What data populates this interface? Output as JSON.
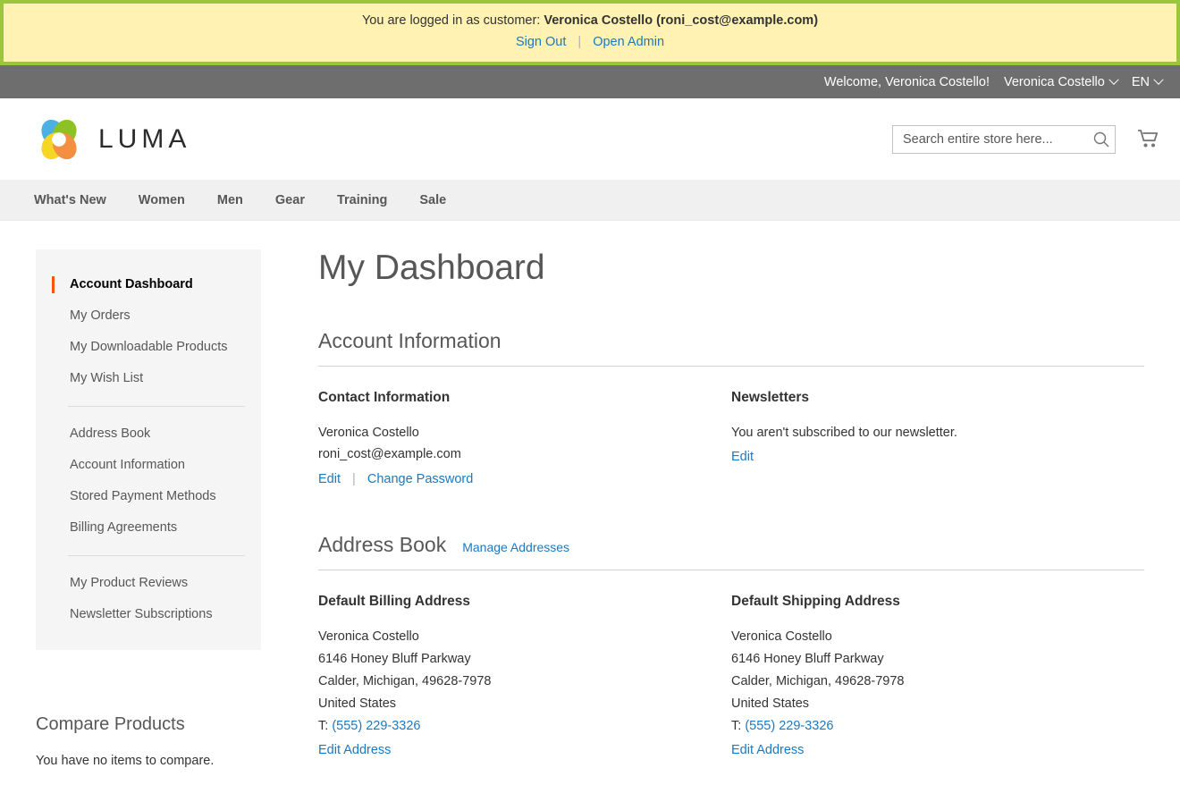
{
  "impersonation": {
    "message_prefix": "You are logged in as customer:",
    "customer": "Veronica Costello (roni_cost@example.com)",
    "sign_out": "Sign Out",
    "open_admin": "Open Admin",
    "separator": "|",
    "banner_bg": "#fff2b3",
    "banner_border": "#9ac63b"
  },
  "panel": {
    "welcome": "Welcome, Veronica Costello!",
    "account_menu": "Veronica Costello",
    "language_menu": "EN",
    "bg": "#6e6e6e"
  },
  "header": {
    "logo_text": "LUMA",
    "search": {
      "placeholder": "Search entire store here...",
      "value": "",
      "icon": "search-icon"
    },
    "cart_icon": "shopping-cart-icon"
  },
  "nav": {
    "items": [
      {
        "label": "What's New"
      },
      {
        "label": "Women"
      },
      {
        "label": "Men"
      },
      {
        "label": "Gear"
      },
      {
        "label": "Training"
      },
      {
        "label": "Sale"
      }
    ]
  },
  "sidebar": {
    "groups": [
      {
        "items": [
          {
            "label": "Account Dashboard",
            "current": true
          },
          {
            "label": "My Orders",
            "current": false
          },
          {
            "label": "My Downloadable Products",
            "current": false
          },
          {
            "label": "My Wish List",
            "current": false
          }
        ]
      },
      {
        "items": [
          {
            "label": "Address Book",
            "current": false
          },
          {
            "label": "Account Information",
            "current": false
          },
          {
            "label": "Stored Payment Methods",
            "current": false
          },
          {
            "label": "Billing Agreements",
            "current": false
          }
        ]
      },
      {
        "items": [
          {
            "label": "My Product Reviews",
            "current": false
          },
          {
            "label": "Newsletter Subscriptions",
            "current": false
          }
        ]
      }
    ],
    "active_color": "#ff5501",
    "compare": {
      "title": "Compare Products",
      "empty_text": "You have no items to compare."
    }
  },
  "main": {
    "page_title": "My Dashboard",
    "account_information": {
      "heading": "Account Information",
      "contact": {
        "title": "Contact Information",
        "name": "Veronica Costello",
        "email": "roni_cost@example.com",
        "edit_label": "Edit",
        "separator": "|",
        "change_password_label": "Change Password"
      },
      "newsletters": {
        "title": "Newsletters",
        "status": "You aren't subscribed to our newsletter.",
        "edit_label": "Edit"
      }
    },
    "address_book": {
      "heading": "Address Book",
      "manage_link": "Manage Addresses",
      "billing": {
        "title": "Default Billing Address",
        "name": "Veronica Costello",
        "street": "6146 Honey Bluff Parkway",
        "city_state_zip": "Calder, Michigan, 49628-7978",
        "country": "United States",
        "phone_prefix": "T:",
        "phone": "(555) 229-3326",
        "edit_label": "Edit Address"
      },
      "shipping": {
        "title": "Default Shipping Address",
        "name": "Veronica Costello",
        "street": "6146 Honey Bluff Parkway",
        "city_state_zip": "Calder, Michigan, 49628-7978",
        "country": "United States",
        "phone_prefix": "T:",
        "phone": "(555) 229-3326",
        "edit_label": "Edit Address"
      }
    }
  },
  "colors": {
    "link": "#1979c3",
    "accent": "#ff5501",
    "text": "#333333"
  }
}
